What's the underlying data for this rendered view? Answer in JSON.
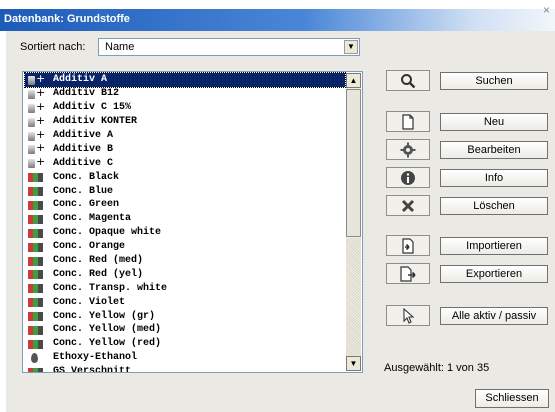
{
  "window": {
    "title": "Datenbank: Grundstoffe",
    "close_glyph": "×"
  },
  "sort": {
    "label": "Sortiert nach:",
    "value": "Name",
    "arrow": "▼"
  },
  "list": {
    "items": [
      {
        "label": "Additiv A",
        "icon": "bottle-plus-icon",
        "selected": true
      },
      {
        "label": "Additiv B12",
        "icon": "bottle-plus-icon"
      },
      {
        "label": "Additiv C 15%",
        "icon": "bottle-plus-icon"
      },
      {
        "label": "Additiv KONTER",
        "icon": "bottle-plus-icon"
      },
      {
        "label": "Additive A",
        "icon": "bottle-plus-icon"
      },
      {
        "label": "Additive B",
        "icon": "bottle-plus-icon"
      },
      {
        "label": "Additive C",
        "icon": "bottle-plus-icon"
      },
      {
        "label": "Conc. Black",
        "icon": "concentrate-icon"
      },
      {
        "label": "Conc. Blue",
        "icon": "concentrate-icon"
      },
      {
        "label": "Conc. Green",
        "icon": "concentrate-icon"
      },
      {
        "label": "Conc. Magenta",
        "icon": "concentrate-icon"
      },
      {
        "label": "Conc. Opaque white",
        "icon": "concentrate-icon"
      },
      {
        "label": "Conc. Orange",
        "icon": "concentrate-icon"
      },
      {
        "label": "Conc. Red (med)",
        "icon": "concentrate-icon"
      },
      {
        "label": "Conc. Red (yel)",
        "icon": "concentrate-icon"
      },
      {
        "label": "Conc. Transp. white",
        "icon": "concentrate-icon"
      },
      {
        "label": "Conc. Violet",
        "icon": "concentrate-icon"
      },
      {
        "label": "Conc. Yellow (gr)",
        "icon": "concentrate-icon"
      },
      {
        "label": "Conc. Yellow (med)",
        "icon": "concentrate-icon"
      },
      {
        "label": "Conc. Yellow (red)",
        "icon": "concentrate-icon"
      },
      {
        "label": "Ethoxy-Ethanol",
        "icon": "solvent-drop-icon"
      },
      {
        "label": "GS Verschnitt",
        "icon": "concentrate-icon"
      }
    ],
    "scroll_up": "▲",
    "scroll_down": "▼"
  },
  "actions": {
    "search": "Suchen",
    "new": "Neu",
    "edit": "Bearbeiten",
    "info": "Info",
    "delete": "Löschen",
    "import": "Importieren",
    "export": "Exportieren",
    "toggle_active": "Alle aktiv / passiv"
  },
  "status": "Ausgewählt: 1 von 35",
  "close_button": "Schliessen",
  "colors": {
    "selection": "#0a246a",
    "title_start": "#1d5bb8",
    "dialog_bg": "#ebe9e4"
  }
}
